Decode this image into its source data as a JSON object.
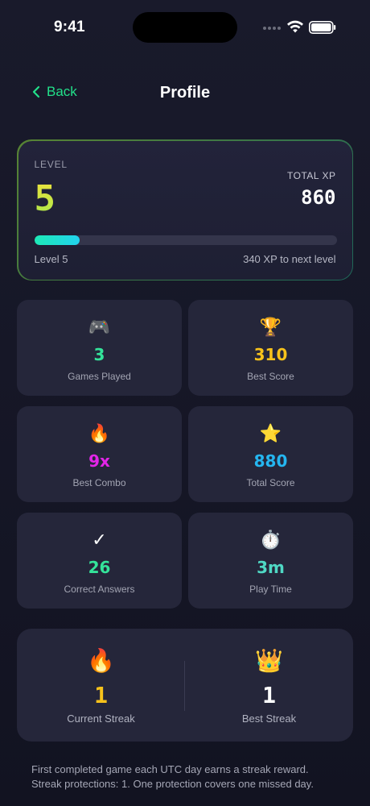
{
  "status_bar": {
    "time": "9:41"
  },
  "nav": {
    "back_label": "Back",
    "title": "Profile"
  },
  "level": {
    "label": "LEVEL",
    "value": "5",
    "total_xp_label": "TOTAL XP",
    "total_xp_value": "860",
    "progress_fraction": 0.15,
    "left_caption": "Level 5",
    "right_caption": "340 XP to next level"
  },
  "stats": [
    {
      "icon": "🎮",
      "icon_name": "gamepad-icon",
      "value": "3",
      "label": "Games Played",
      "color": "#34e39a"
    },
    {
      "icon": "🏆",
      "icon_name": "trophy-icon",
      "value": "310",
      "label": "Best Score",
      "color": "#f7c21b"
    },
    {
      "icon": "🔥",
      "icon_name": "fire-icon",
      "value": "9x",
      "label": "Best Combo",
      "color": "#e325e8"
    },
    {
      "icon": "⭐",
      "icon_name": "star-icon",
      "value": "880",
      "label": "Total Score",
      "color": "#25b6f0"
    },
    {
      "icon": "✓",
      "icon_name": "checkmark-icon",
      "value": "26",
      "label": "Correct Answers",
      "color": "#34e39a"
    },
    {
      "icon": "⏱️",
      "icon_name": "stopwatch-icon",
      "value": "3m",
      "label": "Play Time",
      "color": "#4fd8c4"
    }
  ],
  "streaks": {
    "current": {
      "icon": "🔥",
      "value": "1",
      "label": "Current Streak",
      "color": "#f7c21b"
    },
    "best": {
      "icon": "👑",
      "value": "1",
      "label": "Best Streak",
      "color": "#ffffff"
    }
  },
  "footer": {
    "line1": "First completed game each UTC day earns a streak reward.",
    "line2": "Streak protections: 1. One protection covers one missed day."
  }
}
